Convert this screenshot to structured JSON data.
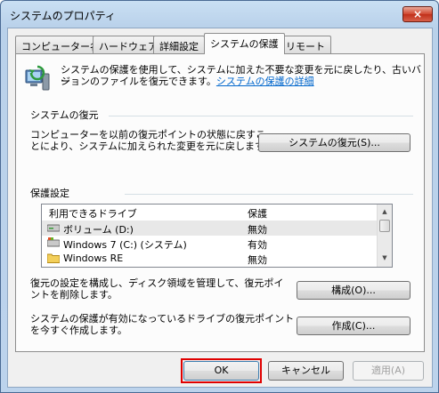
{
  "window": {
    "title": "システムのプロパティ",
    "close_label": "×"
  },
  "tabs": [
    {
      "label": "コンピューター名"
    },
    {
      "label": "ハードウェア"
    },
    {
      "label": "詳細設定"
    },
    {
      "label": "システムの保護"
    },
    {
      "label": "リモート"
    }
  ],
  "intro": {
    "text_line1": "システムの保護を使用して、システムに加えた不要な変更を元に戻したり、古いバー",
    "text_line2": "ジョンのファイルを復元できます。",
    "link": "システムの保護の詳細"
  },
  "restore": {
    "header": "システムの復元",
    "desc_line1": "コンピューターを以前の復元ポイントの状態に戻すこ",
    "desc_line2": "とにより、システムに加えられた変更を元に戻します。",
    "button": "システムの復元(S)..."
  },
  "protection": {
    "header": "保護設定",
    "columns": [
      "利用できるドライブ",
      "保護"
    ],
    "drives": [
      {
        "name": "ボリューム (D:)",
        "status": "無効",
        "icon": "drive-icon"
      },
      {
        "name": "Windows 7 (C:) (システム)",
        "status": "有効",
        "icon": "system-drive-icon"
      },
      {
        "name": "Windows RE",
        "status": "無効",
        "icon": "folder-icon"
      }
    ],
    "configure_desc_line1": "復元の設定を構成し、ディスク領域を管理して、復元ポイ",
    "configure_desc_line2": "ントを削除します。",
    "configure_button": "構成(O)...",
    "create_desc_line1": "システムの保護が有効になっているドライブの復元ポイント",
    "create_desc_line2": "を今すぐ作成します。",
    "create_button": "作成(C)..."
  },
  "footer": {
    "ok": "OK",
    "cancel": "キャンセル",
    "apply": "適用(A)"
  },
  "colors": {
    "highlight": "#e00000",
    "link": "#0066cc",
    "title_bar": "#c9dff3"
  }
}
